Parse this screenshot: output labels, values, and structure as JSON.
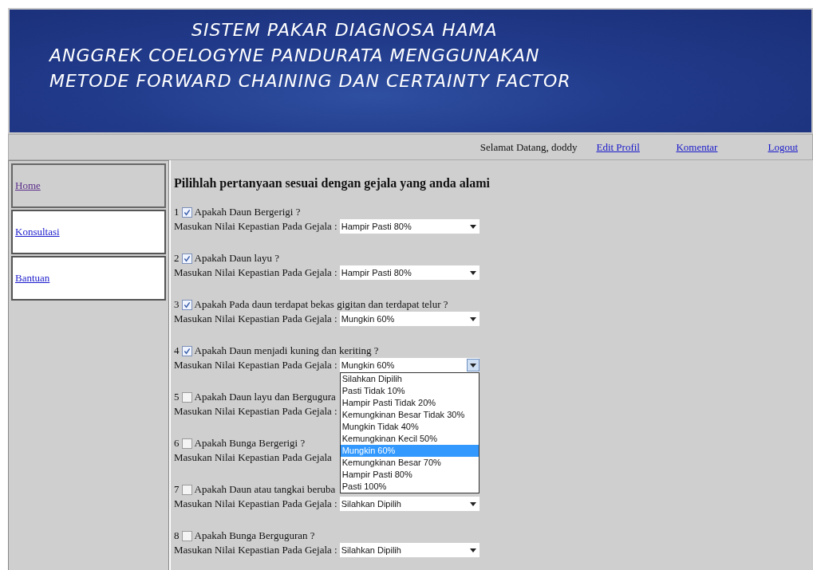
{
  "header": {
    "title_lines": [
      "SISTEM PAKAR DIAGNOSA HAMA",
      "ANGGREK COELOGYNE PANDURATA MENGGUNAKAN",
      "METODE FORWARD CHAINING DAN CERTAINTY FACTOR"
    ]
  },
  "nav": {
    "greeting": "Selamat Datang, doddy",
    "links": [
      "Edit Profil",
      "Komentar",
      "Logout"
    ]
  },
  "sidebar": {
    "items": [
      {
        "label": "Home",
        "selected": true
      },
      {
        "label": "Konsultasi",
        "selected": false
      },
      {
        "label": "Bantuan",
        "selected": false
      }
    ]
  },
  "content": {
    "heading": "Pilihlah pertanyaan sesuai dengan gejala yang anda alami",
    "questions": [
      {
        "number": "1",
        "text": "Apakah Daun Bergerigi ?",
        "checked": true,
        "label": "Masukan Nilai Kepastian Pada Gejala :",
        "value": "Hampir Pasti 80%",
        "expanded": false
      },
      {
        "number": "2",
        "text": "Apakah Daun layu ?",
        "checked": true,
        "label": "Masukan Nilai Kepastian Pada Gejala :",
        "value": "Hampir Pasti 80%",
        "expanded": false
      },
      {
        "number": "3",
        "text": "Apakah Pada daun terdapat bekas gigitan dan terdapat telur ?",
        "checked": true,
        "label": "Masukan Nilai Kepastian Pada Gejala :",
        "value": "Mungkin 60%",
        "expanded": false
      },
      {
        "number": "4",
        "text": "Apakah Daun menjadi kuning dan keriting ?",
        "checked": true,
        "label": "Masukan Nilai Kepastian Pada Gejala :",
        "value": "Mungkin 60%",
        "expanded": true,
        "options": [
          {
            "label": "Silahkan Dipilih",
            "selected": false
          },
          {
            "label": "Pasti Tidak 10%",
            "selected": false
          },
          {
            "label": "Hampir Pasti Tidak 20%",
            "selected": false
          },
          {
            "label": "Kemungkinan Besar Tidak 30%",
            "selected": false
          },
          {
            "label": "Mungkin Tidak 40%",
            "selected": false
          },
          {
            "label": "Kemungkinan Kecil 50%",
            "selected": false
          },
          {
            "label": "Mungkin 60%",
            "selected": true
          },
          {
            "label": "Kemungkinan Besar 70%",
            "selected": false
          },
          {
            "label": "Hampir Pasti 80%",
            "selected": false
          },
          {
            "label": "Pasti 100%",
            "selected": false
          }
        ]
      },
      {
        "number": "5",
        "text": "Apakah Daun layu dan Bergugura",
        "checked": false,
        "label": "Masukan Nilai Kepastian Pada Gejala :"
      },
      {
        "number": "6",
        "text": "Apakah Bunga Bergerigi ?",
        "checked": false,
        "label": "Masukan Nilai Kepastian Pada Gejala"
      },
      {
        "number": "7",
        "text": "Apakah Daun atau tangkai beruba",
        "checked": false,
        "label": "Masukan Nilai Kepastian Pada Gejala :",
        "value": "Silahkan Dipilih",
        "expanded": false
      },
      {
        "number": "8",
        "text": "Apakah Bunga Berguguran ?",
        "checked": false,
        "label": "Masukan Nilai Kepastian Pada Gejala :",
        "value": "Silahkan Dipilih",
        "expanded": false
      }
    ]
  }
}
